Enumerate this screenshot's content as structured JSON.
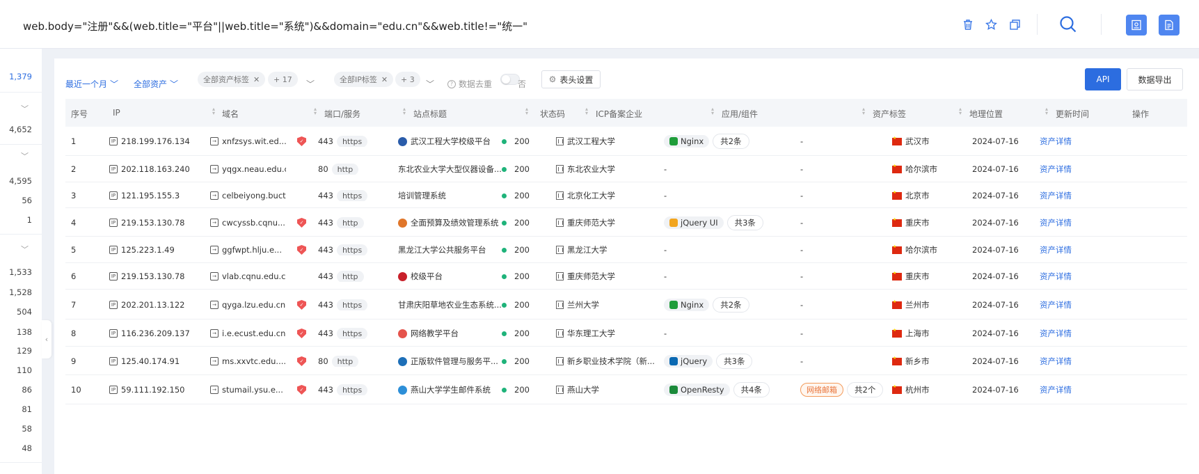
{
  "search": {
    "query": "web.body=\"注册\"&&(web.title=\"平台\"||web.title=\"系统\")&&domain=\"edu.cn\"&&web.title!=\"统一\""
  },
  "topbar_icons": [
    "trash-icon",
    "star-icon",
    "copy-icon",
    "search-icon",
    "book-icon",
    "document-icon"
  ],
  "sidebar": {
    "counts": [
      "1,379",
      "4,652",
      "4,595",
      "56",
      "1",
      "1,533",
      "1,528",
      "504",
      "138",
      "129",
      "110",
      "86",
      "81",
      "58",
      "48"
    ]
  },
  "filters": {
    "time": "最近一个月",
    "assets": "全部资产",
    "asset_tags": "全部资产标签",
    "asset_tags_more": "+ 17",
    "ip_tags": "全部IP标签",
    "ip_tags_more": "+ 3",
    "dedup_label": "数据去重",
    "dedup_value": "否",
    "header_settings": "表头设置",
    "api": "API",
    "export": "数据导出"
  },
  "table": {
    "columns": [
      "序号",
      "IP",
      "域名",
      "端口/服务",
      "站点标题",
      "状态码",
      "ICP备案企业",
      "应用/组件",
      "资产标签",
      "地理位置",
      "更新时间",
      "操作"
    ],
    "rows": [
      {
        "no": "1",
        "ip": "218.199.176.134",
        "domain": "xnfzsys.wit.ed...",
        "shield": true,
        "port": "443",
        "proto": "https",
        "title": "武汉工程大学校级平台",
        "site_icon": "#2a5caa",
        "status": "200",
        "icp": "武汉工程大学",
        "component": "Nginx",
        "comp_color": "#1f9d3a",
        "comp_count": "共2条",
        "tag": "-",
        "tag_count": "",
        "location": "武汉市",
        "updated": "2024-07-16",
        "action": "资产详情"
      },
      {
        "no": "2",
        "ip": "202.118.163.240",
        "domain": "yqgx.neau.edu.cn",
        "shield": false,
        "port": "80",
        "proto": "http",
        "title": "东北农业大学大型仪器设备...",
        "site_icon": "",
        "status": "200",
        "icp": "东北农业大学",
        "component": "-",
        "comp_color": "",
        "comp_count": "",
        "tag": "-",
        "tag_count": "",
        "location": "哈尔滨市",
        "updated": "2024-07-16",
        "action": "资产详情"
      },
      {
        "no": "3",
        "ip": "121.195.155.3",
        "domain": "celbeiyong.buct.e...",
        "shield": false,
        "port": "443",
        "proto": "https",
        "title": "培训管理系统",
        "site_icon": "",
        "status": "200",
        "icp": "北京化工大学",
        "component": "-",
        "comp_color": "",
        "comp_count": "",
        "tag": "-",
        "tag_count": "",
        "location": "北京市",
        "updated": "2024-07-16",
        "action": "资产详情"
      },
      {
        "no": "4",
        "ip": "219.153.130.78",
        "domain": "cwcyssb.cqnu...",
        "shield": true,
        "port": "443",
        "proto": "http",
        "title": "全面预算及绩效管理系统",
        "site_icon": "#e0762a",
        "status": "200",
        "icp": "重庆师范大学",
        "component": "jQuery UI",
        "comp_color": "#f2a51f",
        "comp_count": "共3条",
        "tag": "-",
        "tag_count": "",
        "location": "重庆市",
        "updated": "2024-07-16",
        "action": "资产详情"
      },
      {
        "no": "5",
        "ip": "125.223.1.49",
        "domain": "ggfwpt.hlju.e...",
        "shield": true,
        "port": "443",
        "proto": "https",
        "title": "黑龙江大学公共服务平台",
        "site_icon": "",
        "status": "200",
        "icp": "黑龙江大学",
        "component": "-",
        "comp_color": "",
        "comp_count": "",
        "tag": "-",
        "tag_count": "",
        "location": "哈尔滨市",
        "updated": "2024-07-16",
        "action": "资产详情"
      },
      {
        "no": "6",
        "ip": "219.153.130.78",
        "domain": "vlab.cqnu.edu.cn",
        "shield": false,
        "port": "443",
        "proto": "http",
        "title": "校级平台",
        "site_icon": "#c8202a",
        "status": "200",
        "icp": "重庆师范大学",
        "component": "-",
        "comp_color": "",
        "comp_count": "",
        "tag": "-",
        "tag_count": "",
        "location": "重庆市",
        "updated": "2024-07-16",
        "action": "资产详情"
      },
      {
        "no": "7",
        "ip": "202.201.13.122",
        "domain": "qyga.lzu.edu.cn",
        "shield": true,
        "port": "443",
        "proto": "https",
        "title": "甘肃庆阳草地农业生态系统...",
        "site_icon": "",
        "status": "200",
        "icp": "兰州大学",
        "component": "Nginx",
        "comp_color": "#1f9d3a",
        "comp_count": "共2条",
        "tag": "-",
        "tag_count": "",
        "location": "兰州市",
        "updated": "2024-07-16",
        "action": "资产详情"
      },
      {
        "no": "8",
        "ip": "116.236.209.137",
        "domain": "i.e.ecust.edu.cn",
        "shield": true,
        "port": "443",
        "proto": "https",
        "title": "网络教学平台",
        "site_icon": "#e5534b",
        "status": "200",
        "icp": "华东理工大学",
        "component": "-",
        "comp_color": "",
        "comp_count": "",
        "tag": "-",
        "tag_count": "",
        "location": "上海市",
        "updated": "2024-07-16",
        "action": "资产详情"
      },
      {
        "no": "9",
        "ip": "125.40.174.91",
        "domain": "ms.xxvtc.edu....",
        "shield": true,
        "port": "80",
        "proto": "http",
        "title": "正版软件管理与服务平...",
        "site_icon": "#1d6fb8",
        "status": "200",
        "icp": "新乡职业技术学院（新...",
        "component": "jQuery",
        "comp_color": "#0b69b2",
        "comp_count": "共3条",
        "tag": "-",
        "tag_count": "",
        "location": "新乡市",
        "updated": "2024-07-16",
        "action": "资产详情"
      },
      {
        "no": "10",
        "ip": "59.111.192.150",
        "domain": "stumail.ysu.e...",
        "shield": true,
        "port": "443",
        "proto": "https",
        "title": "燕山大学学生邮件系统",
        "site_icon": "#2d8fd8",
        "status": "200",
        "icp": "燕山大学",
        "component": "OpenResty",
        "comp_color": "#1b8a3a",
        "comp_count": "共4条",
        "tag": "网络邮箱",
        "tag_count": "共2个",
        "location": "杭州市",
        "updated": "2024-07-16",
        "action": "资产详情"
      }
    ]
  }
}
